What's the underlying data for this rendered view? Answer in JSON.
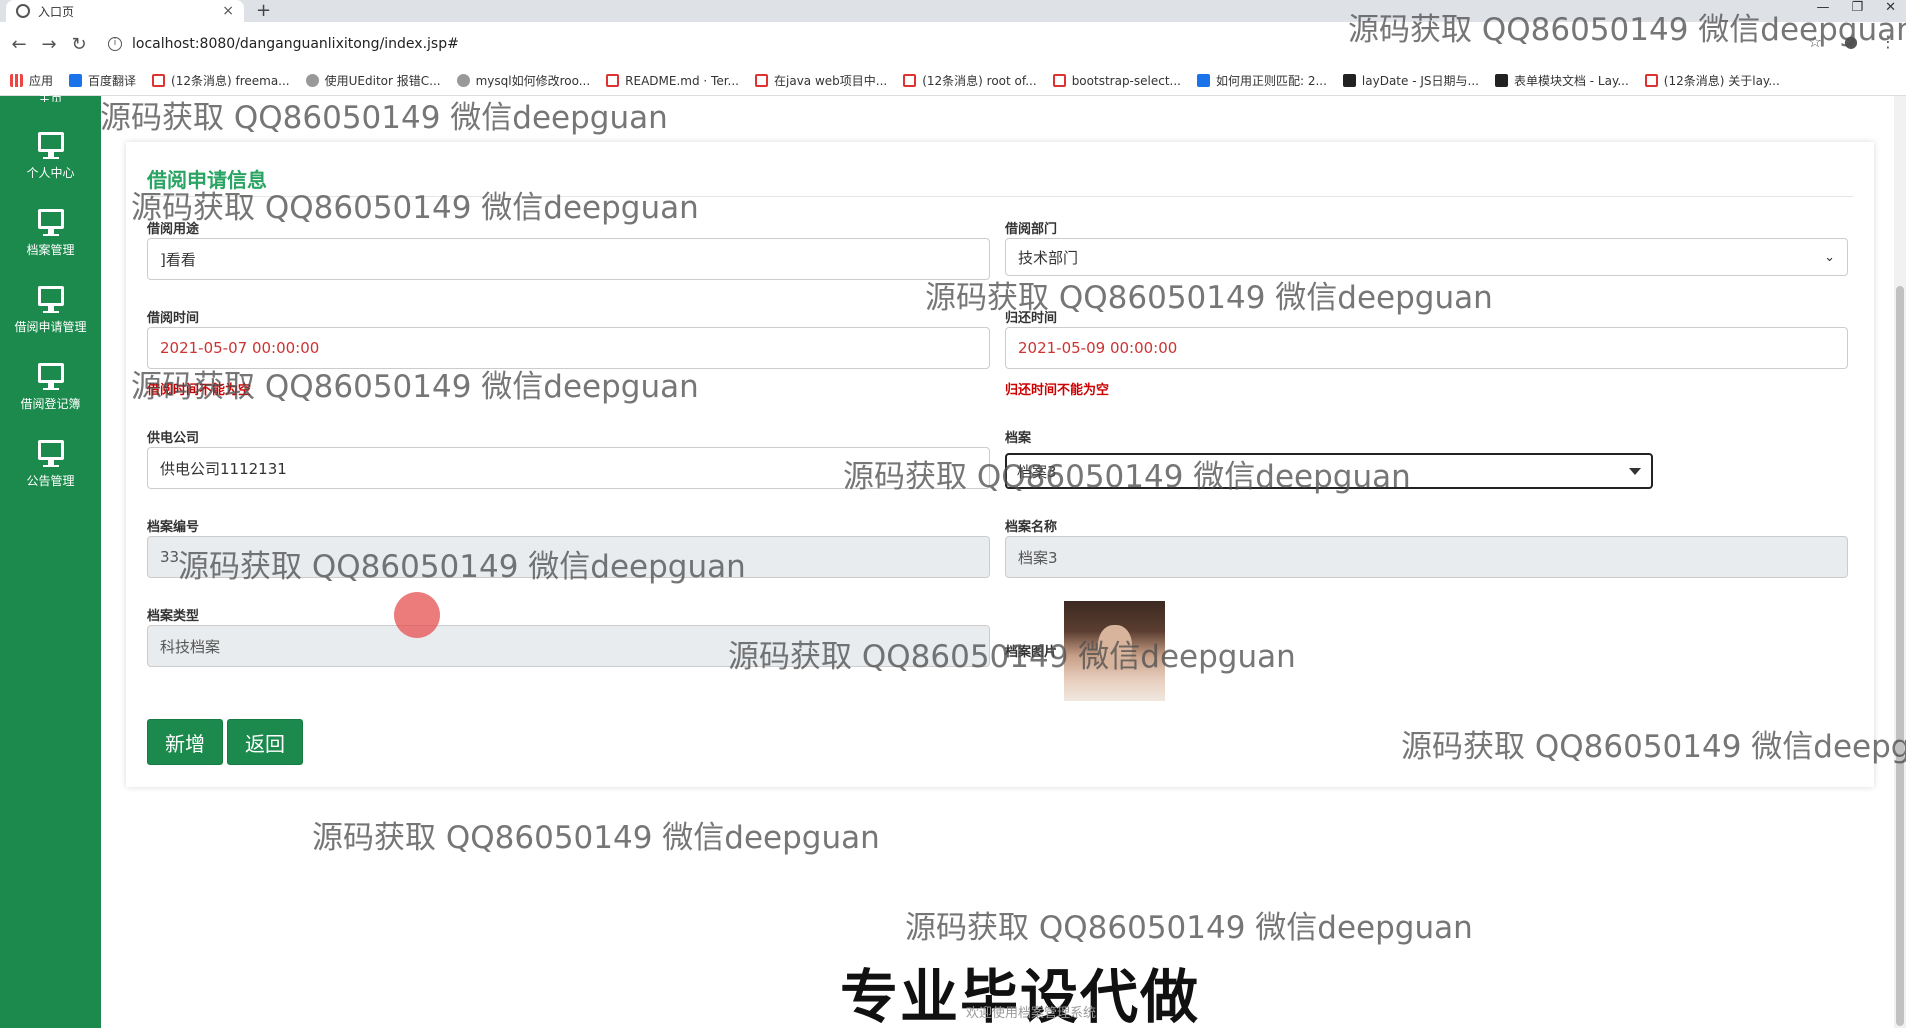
{
  "browser": {
    "tab_title": "入口页",
    "url": "localhost:8080/danganguanlixitong/index.jsp#",
    "bookmarks": [
      "应用",
      "百度翻译",
      "(12条消息) freema...",
      "使用UEditor 报错C...",
      "mysql如何修改roo...",
      "README.md · Ter...",
      "在java web项目中...",
      "(12条消息) root of...",
      "bootstrap-select...",
      "如何用正则匹配: 2...",
      "layDate - JS日期与...",
      "表单模块文档 - Lay...",
      "(12条消息) 关于lay..."
    ]
  },
  "sidebar": {
    "top_label": "主页",
    "items": [
      {
        "label": "个人中心",
        "icon": "monitor-icon"
      },
      {
        "label": "档案管理",
        "icon": "monitor-icon"
      },
      {
        "label": "借阅申请管理",
        "icon": "monitor-icon"
      },
      {
        "label": "借阅登记簿",
        "icon": "monitor-icon"
      },
      {
        "label": "公告管理",
        "icon": "monitor-icon"
      }
    ]
  },
  "form": {
    "title": "借阅申请信息",
    "purpose": {
      "label": "借阅用途",
      "value": "]看看"
    },
    "department": {
      "label": "借阅部门",
      "value": "技术部门"
    },
    "borrow_time": {
      "label": "借阅时间",
      "value": "2021-05-07 00:00:00",
      "error": "借阅时间不能为空"
    },
    "return_time": {
      "label": "归还时间",
      "value": "2021-05-09 00:00:00",
      "error": "归还时间不能为空"
    },
    "power_company": {
      "label": "供电公司",
      "value": "供电公司1112131"
    },
    "archive": {
      "label": "档案",
      "value": "档案3"
    },
    "archive_no": {
      "label": "档案编号",
      "value": "33"
    },
    "archive_name": {
      "label": "档案名称",
      "value": "档案3"
    },
    "archive_type": {
      "label": "档案类型",
      "value": "科技档案"
    },
    "archive_image": {
      "label": "档案图片"
    },
    "add_button": "新增",
    "back_button": "返回"
  },
  "watermark": "源码获取 QQ86050149 微信deepguan",
  "footer": {
    "banner": "专业毕设代做",
    "small": "欢迎使用档案管理系统"
  }
}
